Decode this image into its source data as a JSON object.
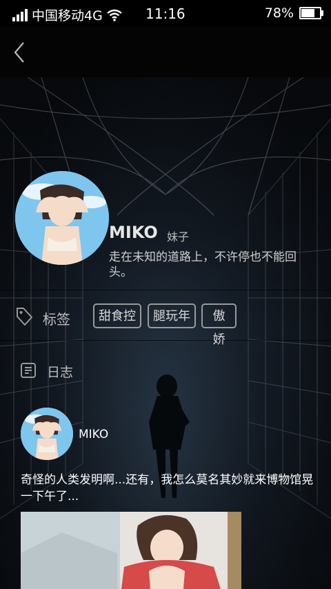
{
  "status_bar": {
    "carrier": "中国移动4G",
    "time": "11:16",
    "battery": "78%",
    "battery_level": 0.78
  },
  "profile": {
    "name": "MIKO",
    "gender_tag": "妹子",
    "bio": "走在未知的道路上，不许停也不能回头。"
  },
  "tags_section": {
    "label": "标签",
    "tags": [
      "甜食控",
      "腿玩年",
      "傲娇"
    ]
  },
  "diary_section": {
    "label": "日志"
  },
  "post": {
    "username": "MIKO",
    "text": "奇怪的人类发明啊...还有，我怎么莫名其妙就来博物馆晃一下午了..."
  }
}
